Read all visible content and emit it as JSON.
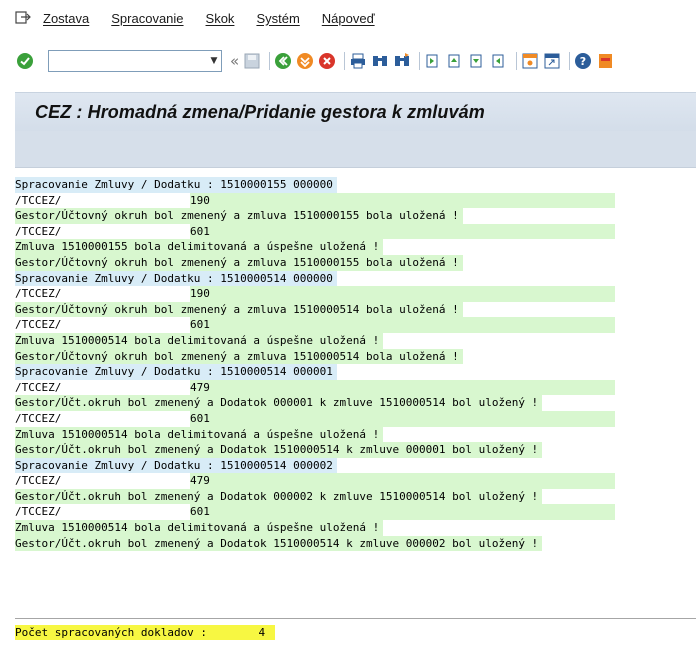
{
  "menubar": {
    "items": [
      "Zostava",
      "Spracovanie",
      "Skok",
      "Systém",
      "Nápoveď"
    ]
  },
  "toolbar": {
    "command_value": "",
    "icons": [
      "check-icon",
      "save-icon",
      "back-icon",
      "exit-icon",
      "cancel-icon",
      "print-icon",
      "find-icon",
      "find-next-icon",
      "first-page-icon",
      "prev-page-icon",
      "next-page-icon",
      "last-page-icon",
      "create-session-icon",
      "shortcut-icon",
      "help-icon",
      "layout-icon"
    ],
    "colors": {
      "green": "#3aa03a",
      "orange": "#f08a24",
      "red": "#d9352a"
    }
  },
  "title": "CEZ : Hromadná zmena/Pridanie gestora k zmluvám",
  "log_rows": [
    {
      "text": "Spracovanie Zmluvy / Dodatku : 1510000155 000000",
      "style": "blue"
    },
    {
      "text": "/TCCEZ/",
      "code": "190",
      "style": "plain"
    },
    {
      "text": "Gestor/Účtovný okruh bol zmenený a zmluva 1510000155 bola uložená !",
      "style": "green"
    },
    {
      "text": "/TCCEZ/",
      "code": "601",
      "style": "plain"
    },
    {
      "text": "Zmluva 1510000155 bola delimitovaná a úspešne uložená !",
      "style": "green"
    },
    {
      "text": "Gestor/Účtovný okruh bol zmenený a zmluva 1510000155 bola uložená !",
      "style": "green"
    },
    {
      "text": "Spracovanie Zmluvy / Dodatku : 1510000514 000000",
      "style": "blue"
    },
    {
      "text": "/TCCEZ/",
      "code": "190",
      "style": "plain"
    },
    {
      "text": "Gestor/Účtovný okruh bol zmenený a zmluva 1510000514 bola uložená !",
      "style": "green"
    },
    {
      "text": "/TCCEZ/",
      "code": "601",
      "style": "plain"
    },
    {
      "text": "Zmluva 1510000514 bola delimitovaná a úspešne uložená !",
      "style": "green"
    },
    {
      "text": "Gestor/Účtovný okruh bol zmenený a zmluva 1510000514 bola uložená !",
      "style": "green"
    },
    {
      "text": "Spracovanie Zmluvy / Dodatku : 1510000514 000001",
      "style": "blue"
    },
    {
      "text": "/TCCEZ/",
      "code": "479",
      "style": "plain"
    },
    {
      "text": "Gestor/Účt.okruh bol zmenený a Dodatok 000001 k zmluve 1510000514 bol uložený !",
      "style": "green"
    },
    {
      "text": "/TCCEZ/",
      "code": "601",
      "style": "plain"
    },
    {
      "text": "Zmluva 1510000514 bola delimitovaná a úspešne uložená !",
      "style": "green"
    },
    {
      "text": "Gestor/Účt.okruh bol zmenený a Dodatok 1510000514 k zmluve 000001 bol uložený !",
      "style": "green"
    },
    {
      "text": "Spracovanie Zmluvy / Dodatku : 1510000514 000002",
      "style": "blue"
    },
    {
      "text": "/TCCEZ/",
      "code": "479",
      "style": "plain"
    },
    {
      "text": "Gestor/Účt.okruh bol zmenený a Dodatok 000002 k zmluve 1510000514 bol uložený !",
      "style": "green"
    },
    {
      "text": "/TCCEZ/",
      "code": "601",
      "style": "plain"
    },
    {
      "text": "Zmluva 1510000514 bola delimitovaná a úspešne uložená !",
      "style": "green"
    },
    {
      "text": "Gestor/Účt.okruh bol zmenený a Dodatok 1510000514 k zmluve 000002 bol uložený !",
      "style": "green"
    }
  ],
  "summary": {
    "label": "Počet spracovaných dokladov :",
    "value": "4"
  }
}
